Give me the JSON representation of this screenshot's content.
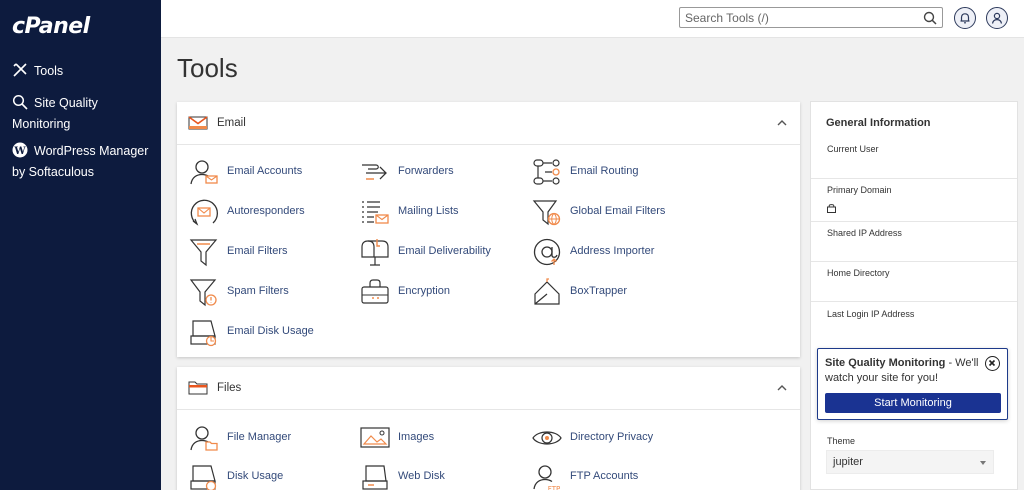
{
  "app": {
    "logo": "cPanel"
  },
  "sidebar": {
    "items": [
      {
        "label": "Tools",
        "icon": "tools-icon"
      },
      {
        "label": "Site Quality",
        "label2": "Monitoring",
        "icon": "search-quality-icon"
      },
      {
        "label": "WordPress Manager",
        "label2": "by Softaculous",
        "icon": "wordpress-icon"
      }
    ]
  },
  "topbar": {
    "search_placeholder": "Search Tools (/)"
  },
  "page": {
    "title": "Tools"
  },
  "email_panel": {
    "title": "Email",
    "tools": [
      {
        "label": "Email Accounts",
        "icon": "user-email-icon"
      },
      {
        "label": "Forwarders",
        "icon": "forward-arrow-icon"
      },
      {
        "label": "Email Routing",
        "icon": "routing-icon"
      },
      {
        "label": "Autoresponders",
        "icon": "autoresponder-icon"
      },
      {
        "label": "Mailing Lists",
        "icon": "mailing-list-icon"
      },
      {
        "label": "Global Email Filters",
        "icon": "global-filter-icon"
      },
      {
        "label": "Email Filters",
        "icon": "funnel-icon"
      },
      {
        "label": "Email Deliverability",
        "icon": "mailbox-icon"
      },
      {
        "label": "Address Importer",
        "icon": "at-sign-icon"
      },
      {
        "label": "Spam Filters",
        "icon": "spam-funnel-icon"
      },
      {
        "label": "Encryption",
        "icon": "encryption-icon"
      },
      {
        "label": "BoxTrapper",
        "icon": "boxtrapper-icon"
      },
      {
        "label": "Email Disk Usage",
        "icon": "disk-usage-icon"
      }
    ]
  },
  "files_panel": {
    "title": "Files",
    "tools": [
      {
        "label": "File Manager",
        "icon": "file-manager-icon"
      },
      {
        "label": "Images",
        "icon": "image-icon"
      },
      {
        "label": "Directory Privacy",
        "icon": "eye-icon"
      },
      {
        "label": "Disk Usage",
        "icon": "disk-icon"
      },
      {
        "label": "Web Disk",
        "icon": "web-disk-icon"
      },
      {
        "label": "FTP Accounts",
        "icon": "ftp-accounts-icon"
      }
    ]
  },
  "info": {
    "title": "General Information",
    "rows": [
      {
        "label": "Current User"
      },
      {
        "label": "Primary Domain"
      },
      {
        "label": "Shared IP Address"
      },
      {
        "label": "Home Directory"
      },
      {
        "label": "Last Login IP Address"
      }
    ],
    "theme_label": "Theme",
    "theme_value": "jupiter"
  },
  "monitor_card": {
    "title": "Site Quality Monitoring",
    "text": " - We'll watch your site for you!",
    "button": "Start Monitoring"
  },
  "colors": {
    "sidebar": "#0d1b3e",
    "accent_orange": "#f08a4b",
    "link_blue": "#334a7a",
    "button_blue": "#1a3392"
  }
}
